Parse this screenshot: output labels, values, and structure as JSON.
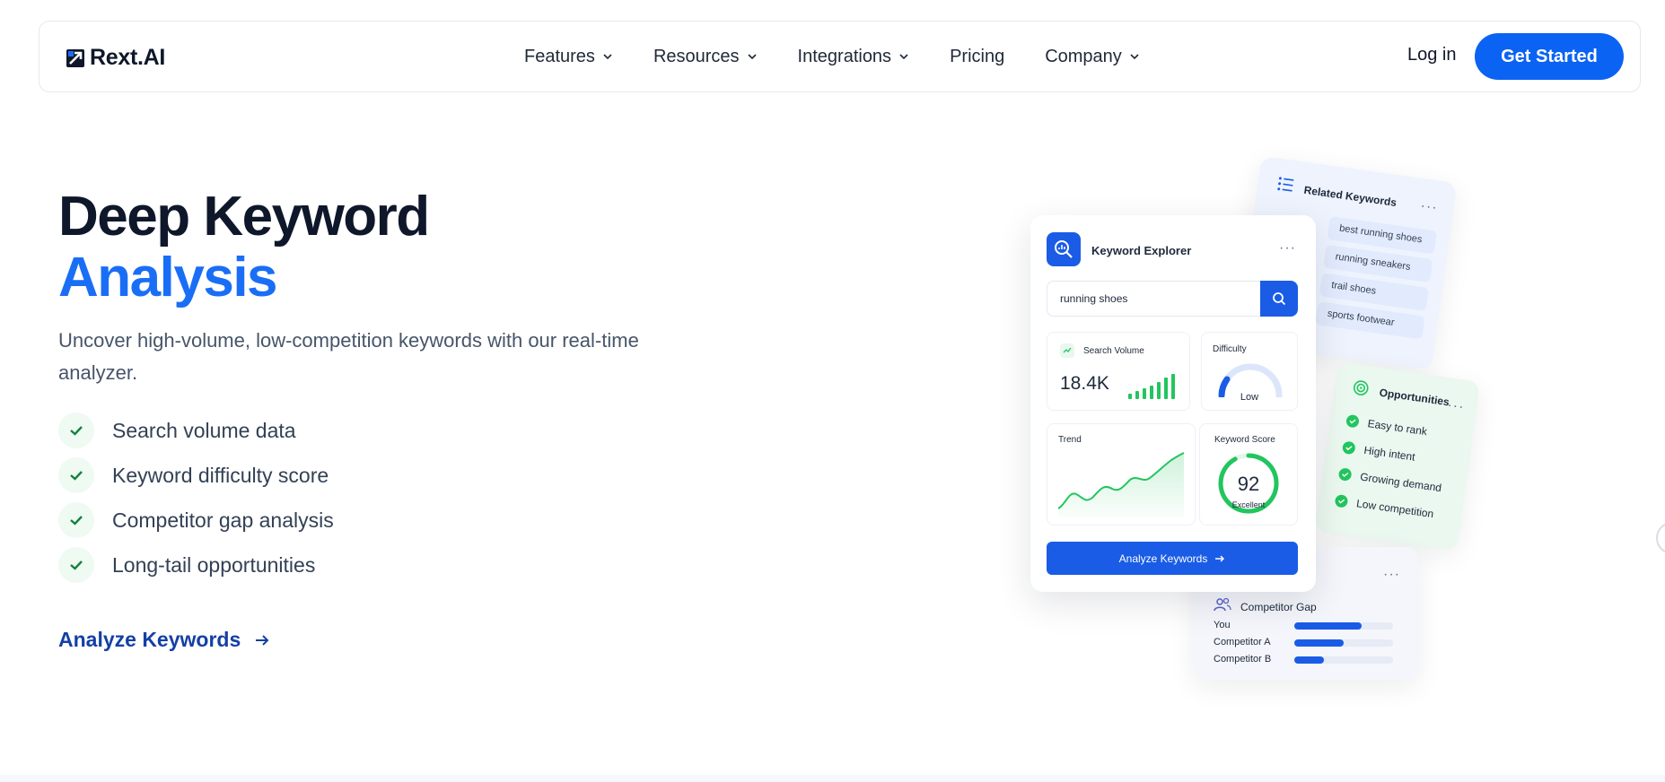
{
  "brand": {
    "name": "Rext.AI",
    "accent": "#0b63f3"
  },
  "nav": {
    "items": [
      {
        "label": "Features",
        "dropdown": true
      },
      {
        "label": "Resources",
        "dropdown": true
      },
      {
        "label": "Integrations",
        "dropdown": true
      },
      {
        "label": "Pricing",
        "dropdown": false
      },
      {
        "label": "Company",
        "dropdown": true
      }
    ],
    "login_label": "Log in",
    "cta_label": "Get Started"
  },
  "hero": {
    "title_line1": "Deep Keyword",
    "title_line2": "Analysis",
    "subtitle": "Uncover high-volume, low-competition keywords with our real-time analyzer.",
    "features": [
      "Search volume data",
      "Keyword difficulty score",
      "Competitor gap analysis",
      "Long-tail opportunities"
    ],
    "link_label": "Analyze Keywords"
  },
  "illustration": {
    "explorer": {
      "title": "Keyword Explorer",
      "search_value": "running shoes",
      "volume_label": "Search Volume",
      "volume_value": "18.4K",
      "difficulty_label": "Difficulty",
      "difficulty_value": "Low",
      "trend_label": "Trend",
      "score_label": "Keyword Score",
      "score_value": "92",
      "score_sub": "Excellent",
      "button_label": "Analyze Keywords"
    },
    "related": {
      "title": "Related Keywords",
      "items": [
        "best running shoes",
        "running sneakers",
        "trail shoes",
        "sports footwear"
      ]
    },
    "opportunities": {
      "title": "Opportunities",
      "items": [
        "Easy to rank",
        "High intent",
        "Growing demand",
        "Low competition"
      ]
    },
    "competitor": {
      "title": "Competitor Gap",
      "rows": [
        {
          "label": "You",
          "share": 0.68
        },
        {
          "label": "Competitor A",
          "share": 0.5
        },
        {
          "label": "Competitor B",
          "share": 0.3
        }
      ]
    }
  }
}
